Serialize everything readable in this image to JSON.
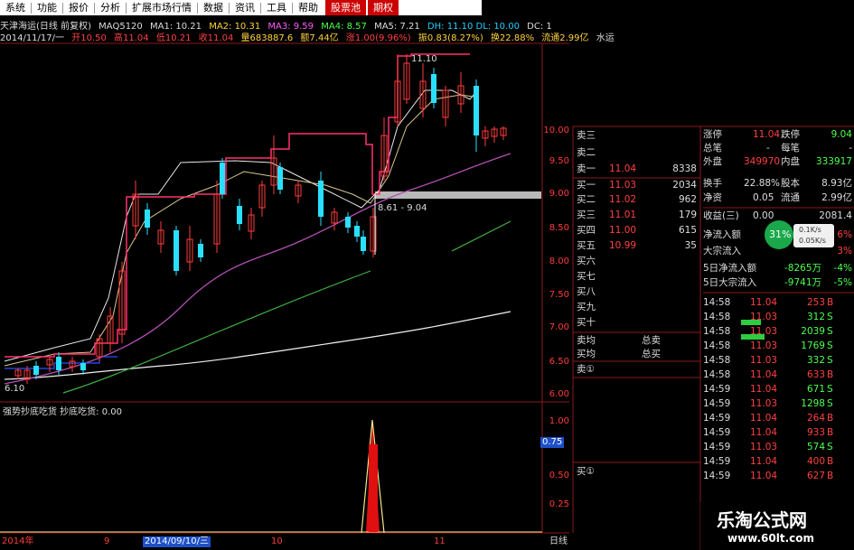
{
  "menu": [
    "系统",
    "功能",
    "报价",
    "分析",
    "扩展市场行情",
    "|",
    "数据",
    "资讯",
    "工具",
    "帮助"
  ],
  "menu_highlight": [
    "股票池",
    "期权"
  ],
  "header": {
    "stock_name": "天津海运(日线 前复权)",
    "ma_label": "MAQ5120",
    "ma1": "MA1: 10.21",
    "ma2": "MA2: 10.31",
    "ma3": "MA3: 9.59",
    "ma4": "MA4: 8.57",
    "ma5": "MA5: 7.21",
    "extra": "DH: 11.10 DL: 10.00",
    "dc": "DC: 1"
  },
  "quote_line": {
    "date": "2014/11/17/一",
    "open": "开10.50",
    "high": "高11.04",
    "low": "低10.21",
    "close": "收11.04",
    "volume": "量683887.6",
    "amount": "额7.44亿",
    "change": "涨1.00(9.96%)",
    "amp": "振0.83(8.27%)",
    "turnover": "换22.88%",
    "float": "流通2.99亿",
    "extra": "水运"
  },
  "chart": {
    "price_axis": [
      "10.00",
      "9.50",
      "9.00",
      "8.50",
      "8.00",
      "7.50",
      "7.00",
      "6.50",
      "6.00"
    ],
    "max_label": "11.10",
    "min_label": "6.10",
    "range_label": "8.61 - 9.04",
    "indicator_title": "强势抄底吃货 抄底吃货: 0.00",
    "indicator_axis": [
      "1.00",
      "0.75",
      "0.50",
      "0.25"
    ],
    "date_axis": [
      "2014年",
      "9",
      "2014/09/10/三",
      "10",
      "11"
    ],
    "daily_label": "日线"
  },
  "orderbook": {
    "sell": [
      {
        "name": "卖三",
        "price": "",
        "vol": ""
      },
      {
        "name": "卖二",
        "price": "",
        "vol": ""
      },
      {
        "name": "卖一",
        "price": "11.04",
        "vol": "8338"
      }
    ],
    "buy": [
      {
        "name": "买一",
        "price": "11.03",
        "vol": "2034"
      },
      {
        "name": "买二",
        "price": "11.02",
        "vol": "962"
      },
      {
        "name": "买三",
        "price": "11.01",
        "vol": "179"
      },
      {
        "name": "买四",
        "price": "11.00",
        "vol": "615"
      },
      {
        "name": "买五",
        "price": "10.99",
        "vol": "35"
      },
      {
        "name": "买六",
        "price": "",
        "vol": ""
      },
      {
        "name": "买七",
        "price": "",
        "vol": ""
      },
      {
        "name": "买八",
        "price": "",
        "vol": ""
      },
      {
        "name": "买九",
        "price": "",
        "vol": ""
      },
      {
        "name": "买十",
        "price": "",
        "vol": ""
      }
    ],
    "sell_avg": "卖均",
    "buy_avg": "买均",
    "total_sell": "总卖",
    "total_buy": "总买",
    "sell_zero": "卖①",
    "buy_zero": "买①"
  },
  "stats": [
    {
      "k1": "涨停",
      "v1": "11.04",
      "k2": "跌停",
      "v2": "9.04"
    },
    {
      "k1": "总笔",
      "v1": "-",
      "k2": "每笔",
      "v2": "-"
    },
    {
      "k1": "外盘",
      "v1": "349970",
      "k2": "内盘",
      "v2": "333917"
    },
    {
      "k1": "换手",
      "v1": "22.88%",
      "k2": "股本",
      "v2": "8.93亿"
    },
    {
      "k1": "净资",
      "v1": "0.05",
      "k2": "流通",
      "v2": "2.99亿"
    },
    {
      "k1": "收益(三)",
      "v1": "0.00",
      "k2": "",
      "v2": "2081.4"
    }
  ],
  "flows": [
    {
      "label": "净流入额",
      "value": "",
      "pct": "6%"
    },
    {
      "label": "大宗流入",
      "value": "",
      "pct": "3%"
    },
    {
      "label": "5日净流入额",
      "value": "-8265万",
      "pct": "-4%"
    },
    {
      "label": "5日大宗流入",
      "value": "-9741万",
      "pct": "-5%"
    }
  ],
  "gauge": {
    "pct": "31%",
    "up": "0.1K/s",
    "down": "0.05K/s"
  },
  "trades": [
    {
      "time": "14:58",
      "price": "11.04",
      "vol": "253",
      "side": "B"
    },
    {
      "time": "14:58",
      "price": "11.03",
      "vol": "312",
      "side": "S"
    },
    {
      "time": "14:58",
      "price": "11.03",
      "vol": "2039",
      "side": "S"
    },
    {
      "time": "14:58",
      "price": "11.03",
      "vol": "1769",
      "side": "S"
    },
    {
      "time": "14:58",
      "price": "11.03",
      "vol": "332",
      "side": "S"
    },
    {
      "time": "14:58",
      "price": "11.04",
      "vol": "633",
      "side": "B"
    },
    {
      "time": "14:59",
      "price": "11.04",
      "vol": "671",
      "side": "S"
    },
    {
      "time": "14:59",
      "price": "11.03",
      "vol": "1298",
      "side": "S"
    },
    {
      "time": "14:59",
      "price": "11.04",
      "vol": "264",
      "side": "B"
    },
    {
      "time": "14:59",
      "price": "11.04",
      "vol": "933",
      "side": "B"
    },
    {
      "time": "14:59",
      "price": "11.03",
      "vol": "574",
      "side": "S"
    },
    {
      "time": "14:59",
      "price": "11.04",
      "vol": "400",
      "side": "B"
    },
    {
      "time": "14:59",
      "price": "11.04",
      "vol": "627",
      "side": "B"
    }
  ],
  "watermark": {
    "title": "乐淘公式网",
    "url": "www.60lt.com"
  }
}
